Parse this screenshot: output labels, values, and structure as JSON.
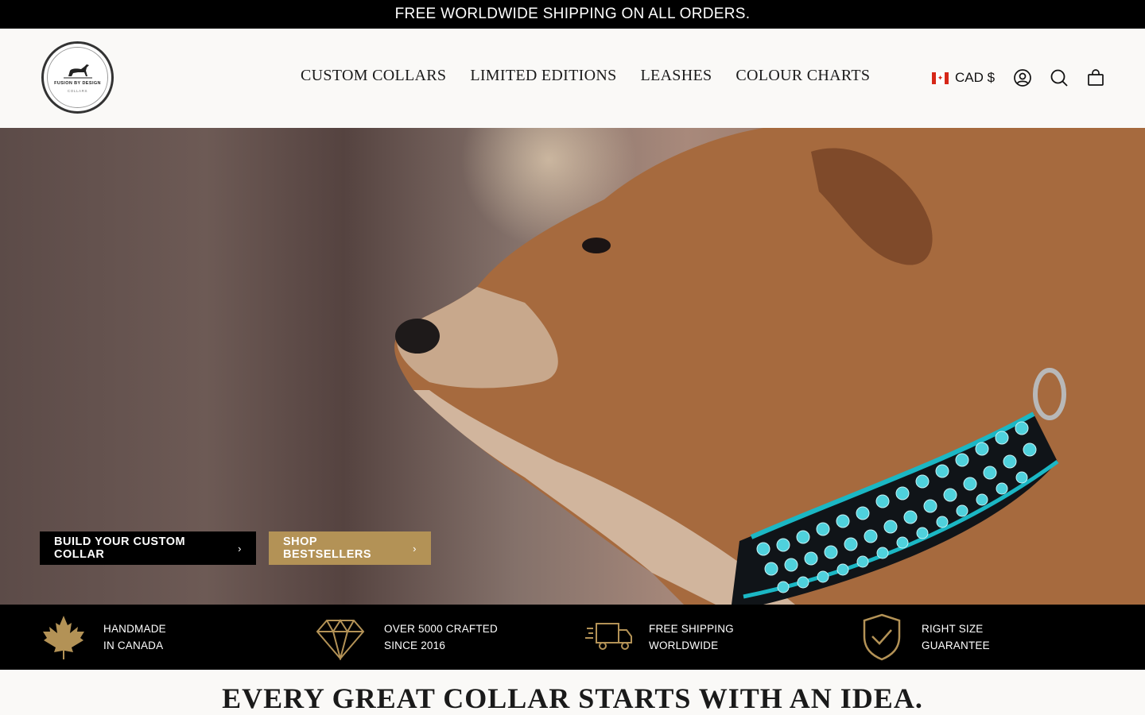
{
  "announcement": "FREE WORLDWIDE SHIPPING ON ALL ORDERS.",
  "logo": {
    "name": "FUSION BY DESIGN",
    "sub": "COLLARS"
  },
  "nav": [
    "CUSTOM COLLARS",
    "LIMITED EDITIONS",
    "LEASHES",
    "COLOUR CHARTS"
  ],
  "currency": {
    "label": "CAD $",
    "flag_icon": "canada-flag-icon"
  },
  "header_icons": [
    "account-icon",
    "search-icon",
    "cart-icon"
  ],
  "hero": {
    "primary_button": "BUILD YOUR CUSTOM COLLAR",
    "secondary_button": "SHOP BESTSELLERS",
    "accent_color": "#b39256"
  },
  "features": [
    {
      "icon": "maple-leaf-icon",
      "line1": "HANDMADE",
      "line2": "IN CANADA"
    },
    {
      "icon": "diamond-icon",
      "line1": "OVER 5000 CRAFTED",
      "line2": "SINCE 2016"
    },
    {
      "icon": "delivery-truck-icon",
      "line1": "FREE SHIPPING",
      "line2": "WORLDWIDE"
    },
    {
      "icon": "shield-check-icon",
      "line1": "RIGHT SIZE",
      "line2": "GUARANTEE"
    }
  ],
  "headline": "EVERY GREAT COLLAR STARTS WITH AN IDEA."
}
